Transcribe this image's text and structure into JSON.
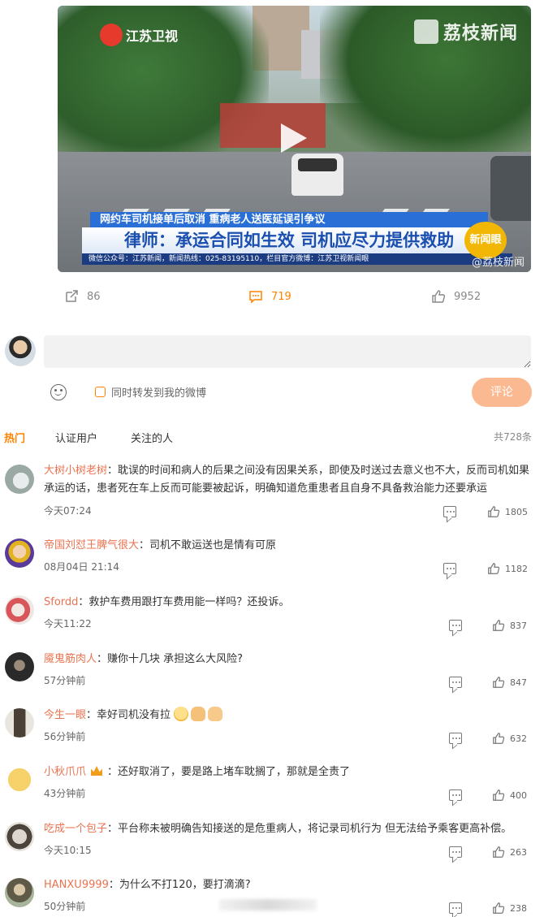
{
  "video": {
    "channel_logo": "江苏卫视",
    "source_logo": "荔枝新闻",
    "sub_headline": "网约车司机接单后取消  重病老人送医延误引争议",
    "headline": "律师：承运合同如生效  司机应尽力提供救助",
    "ticker": "微信公众号：江苏新闻，新闻热线：025-83195110，栏目官方微博：江苏卫视新闻眼",
    "badge": "新闻眼",
    "watermark": "@荔枝新闻"
  },
  "actions": {
    "repost_count": "86",
    "comment_count": "719",
    "like_count": "9952"
  },
  "composer": {
    "placeholder": "",
    "forward_label": "同时转发到我的微博",
    "submit_label": "评论"
  },
  "tabs": {
    "hot": "热门",
    "verified": "认证用户",
    "following": "关注的人",
    "total": "共728条"
  },
  "comments": [
    {
      "name": "大树小树老树",
      "text": "耽误的时间和病人的后果之间没有因果关系，即使及时送过去意义也不大，反而司机如果承运的话，患者死在车上反而可能要被起诉，明确知道危重患者且自身不具备救治能力还要承运",
      "time": "今天07:24",
      "likes": "1805"
    },
    {
      "name": "帝国刘怼王脾气很大",
      "text": "司机不敢运送也是情有可原",
      "time": "08月04日 21:14",
      "likes": "1182"
    },
    {
      "name": "Sfordd",
      "text": "救护车费用跟打车费用能一样吗？还投诉。",
      "time": "今天11:22",
      "likes": "837"
    },
    {
      "name": "魇鬼筋肉人",
      "text": "赚你十几块 承担这么大风险?",
      "time": "57分钟前",
      "likes": "847"
    },
    {
      "name": "今生一眼",
      "text": "幸好司机没有拉",
      "time": "56分钟前",
      "likes": "632"
    },
    {
      "name": "小秋爪爪",
      "text": "还好取消了，要是路上堵车耽搁了，那就是全责了",
      "time": "43分钟前",
      "likes": "400"
    },
    {
      "name": "吃成一个包子",
      "text": "平台称未被明确告知接送的是危重病人，将记录司机行为 但无法给予乘客更高补偿。",
      "time": "今天10:15",
      "likes": "263"
    },
    {
      "name": "HANXU9999",
      "text": "为什么不打120，要打滴滴?",
      "time": "50分钟前",
      "likes": "238"
    }
  ],
  "colors": {
    "accent": "#ff8200",
    "username": "#eb7350",
    "submit_bg": "#fbb991"
  }
}
